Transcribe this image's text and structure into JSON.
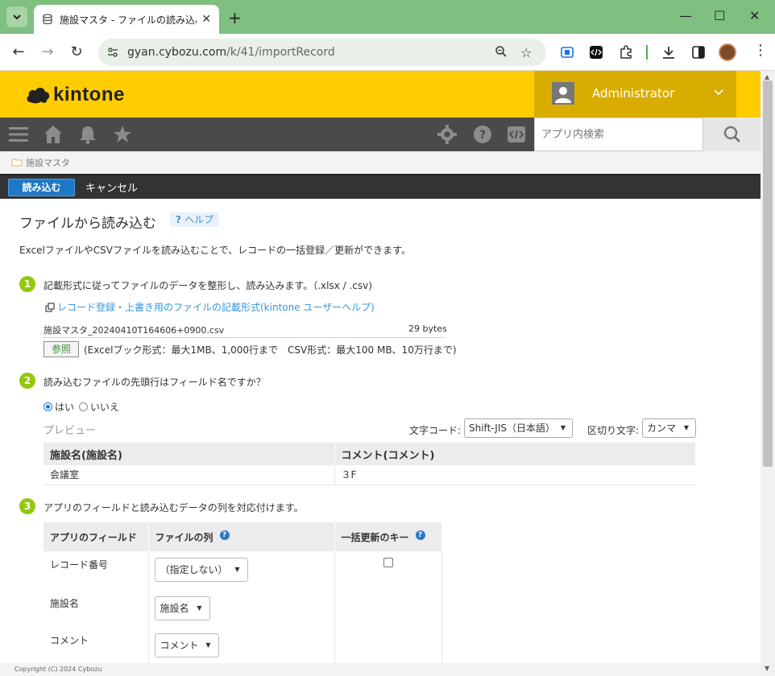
{
  "browser": {
    "tab_title": "施設マスタ - ファイルの読み込み",
    "url_host": "gyan.cybozu.com",
    "url_path": "/k/41/importRecord"
  },
  "header": {
    "logo_text": "kintone",
    "user_name": "Administrator",
    "search_placeholder": "アプリ内検索"
  },
  "breadcrumb": {
    "app_name": "施設マスタ"
  },
  "toolbar": {
    "import_label": "読み込む",
    "cancel_label": "キャンセル"
  },
  "page": {
    "title": "ファイルから読み込む",
    "help_label": "ヘルプ",
    "intro": "ExcelファイルやCSVファイルを読み込むことで、レコードの一括登録／更新ができます。"
  },
  "step1": {
    "num": "1",
    "text": "記載形式に従ってファイルのデータを整形し、読み込みます。（.xlsx / .csv)",
    "link": "レコード登録・上書き用のファイルの記載形式(kintone ユーザーヘルプ)",
    "file_name": "施設マスタ_20240410T164606+0900.csv",
    "file_size": "29 bytes",
    "browse_label": "参照",
    "limit_text": "(Excelブック形式：最大1MB、1,000行まで　CSV形式：最大100 MB、10万行まで)"
  },
  "step2": {
    "num": "2",
    "text": "読み込むファイルの先頭行はフィールド名ですか？",
    "yes_label": "はい",
    "no_label": "いいえ",
    "preview_label": "プレビュー",
    "encoding_label": "文字コード:",
    "encoding_value": "Shift-JIS（日本語）",
    "delimiter_label": "区切り文字:",
    "delimiter_value": "カンマ",
    "preview_headers": [
      "施設名(施設名)",
      "コメント(コメント)"
    ],
    "preview_rows": [
      [
        "会議室",
        "３F"
      ]
    ]
  },
  "step3": {
    "num": "3",
    "text": "アプリのフィールドと読み込むデータの列を対応付けます。",
    "headers": [
      "アプリのフィールド",
      "ファイルの列",
      "一括更新のキー"
    ],
    "rows": [
      {
        "field": "レコード番号",
        "column": "（指定しない）"
      },
      {
        "field": "施設名",
        "column": "施設名"
      },
      {
        "field": "コメント",
        "column": "コメント"
      }
    ]
  },
  "footer": {
    "copyright": "Copyright (C) 2024 Cybozu"
  },
  "colors": {
    "accent_yellow": "#ffcc00",
    "step_green": "#94c70f",
    "link_blue": "#3498db",
    "primary_button": "#1e78c8"
  }
}
